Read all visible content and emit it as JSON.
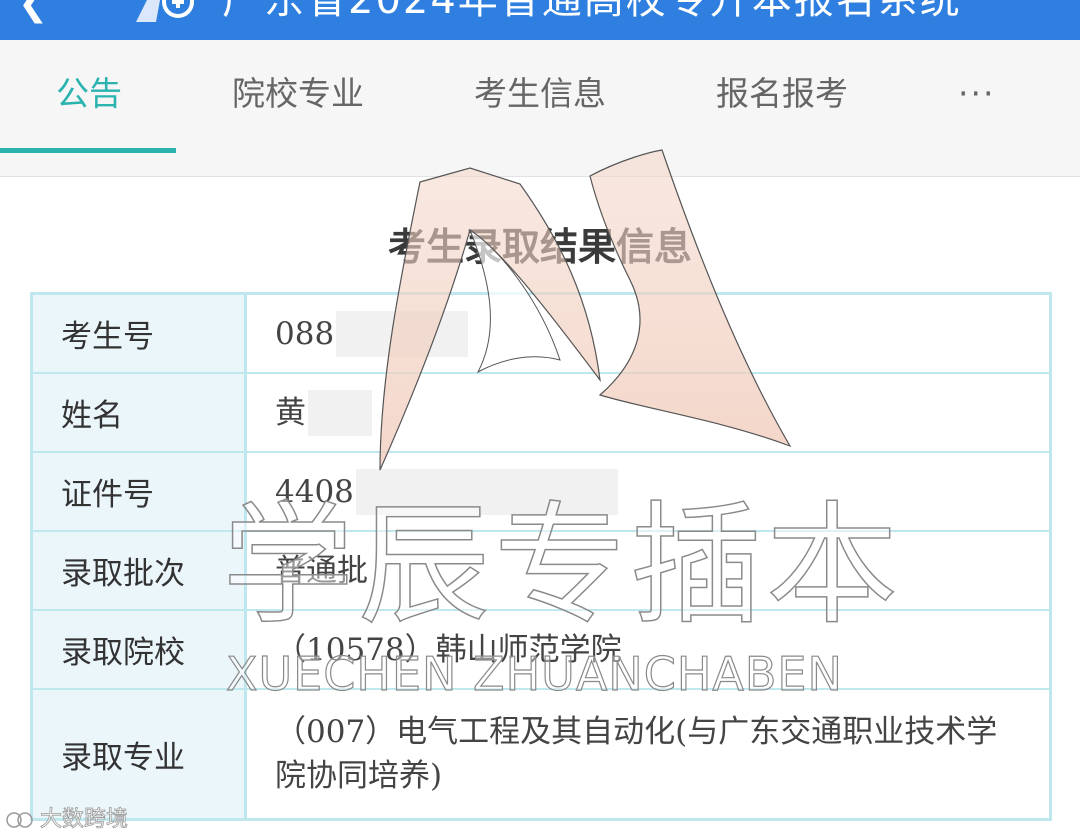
{
  "header": {
    "title": "广东省2024年普通高校专升本报名系统",
    "back_icon": "chevron-left-icon",
    "logo_icon": "app-logo-icon",
    "colors": {
      "bar": "#2f7fe0"
    }
  },
  "tabs": [
    {
      "label": "公告",
      "active": true
    },
    {
      "label": "院校专业",
      "active": false
    },
    {
      "label": "考生信息",
      "active": false
    },
    {
      "label": "报名报考",
      "active": false
    },
    {
      "label": "···",
      "active": false
    }
  ],
  "accent_color": "#2bb3b0",
  "card": {
    "title": "考生录取结果信息",
    "rows": [
      {
        "label": "考生号",
        "value": "088",
        "redacted": true
      },
      {
        "label": "姓名",
        "value": "黄",
        "redacted": true
      },
      {
        "label": "证件号",
        "value": "4408",
        "redacted": true
      },
      {
        "label": "录取批次",
        "value": "普通批"
      },
      {
        "label": "录取院校",
        "value": "（10578）韩山师范学院"
      },
      {
        "label": "录取专业",
        "value": "（007）电气工程及其自动化(与广东交通职业技术学院协同培养)"
      }
    ]
  },
  "watermarks": {
    "brand_cn": "学辰专插本",
    "brand_latin": "XUECHEN ZHUANCHABEN",
    "corner": "大数跨境"
  }
}
